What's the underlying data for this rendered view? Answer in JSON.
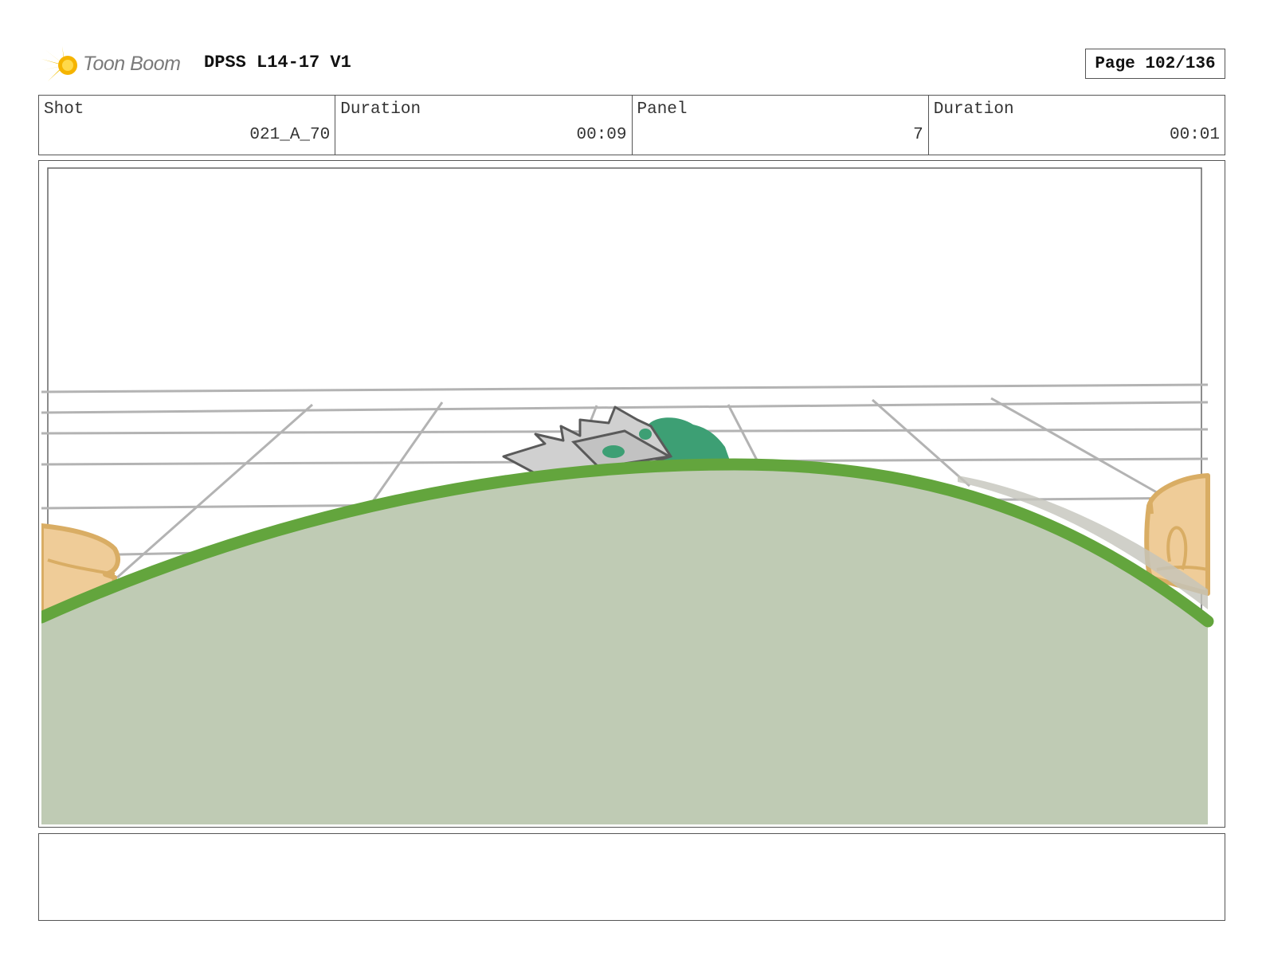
{
  "header": {
    "logo_text": "Toon Boom",
    "project_title": "DPSS L14-17 V1",
    "page_label": "Page 102/136"
  },
  "info": {
    "shot_label": "Shot",
    "shot_value": "021_A_70",
    "shot_duration_label": "Duration",
    "shot_duration_value": "00:09",
    "panel_label": "Panel",
    "panel_value": "7",
    "panel_duration_label": "Duration",
    "panel_duration_value": "00:01"
  },
  "colors": {
    "ground_fill": "#bfcbb4",
    "ground_outline": "#63a53d",
    "creature_green": "#3d9f74",
    "hand_fill": "#efcc98",
    "hand_outline": "#d9ad64",
    "grid_line": "#b3b3b3",
    "logo_yellow": "#f2c20c"
  },
  "icons": {
    "logo": "toon-boom-star-icon"
  },
  "notes": ""
}
